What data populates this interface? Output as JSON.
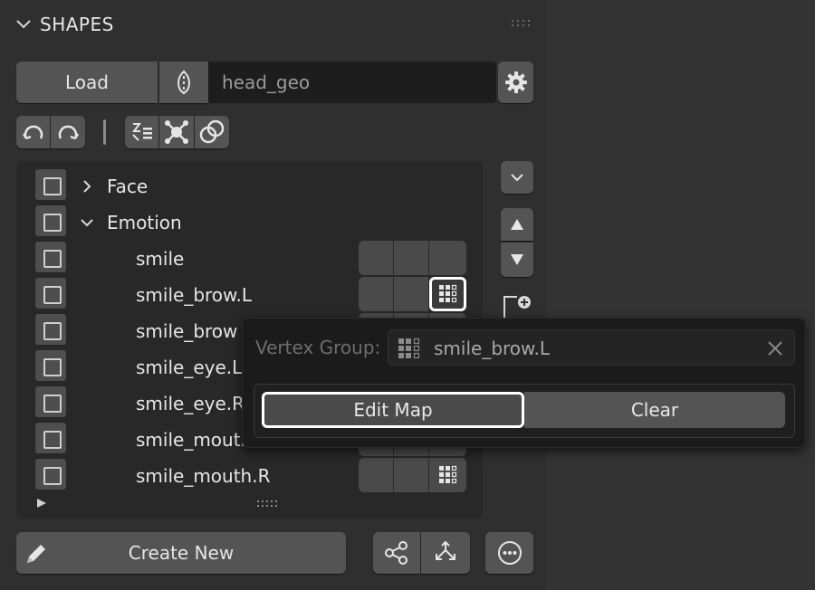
{
  "panel": {
    "title": "SHAPES"
  },
  "toolbar": {
    "load_label": "Load",
    "mesh_name": "head_geo"
  },
  "tree": {
    "items": [
      {
        "label": "Face"
      },
      {
        "label": "Emotion"
      },
      {
        "label": "smile"
      },
      {
        "label": "smile_brow.L"
      },
      {
        "label": "smile_brow"
      },
      {
        "label": "smile_eye.L"
      },
      {
        "label": "smile_eye.R"
      },
      {
        "label": "smile_mouth"
      },
      {
        "label": "smile_mouth.R"
      }
    ]
  },
  "popup": {
    "vertex_group_label": "Vertex Group:",
    "vertex_group_value": "smile_brow.L",
    "edit_map_label": "Edit Map",
    "clear_label": "Clear"
  },
  "footer": {
    "create_new_label": "Create New"
  },
  "colors": {
    "panel_bg": "#2f2f2f",
    "button_bg": "#545454",
    "field_bg": "#1d1d1d",
    "popup_bg": "#1b1b1b",
    "highlight": "#ffffff"
  }
}
